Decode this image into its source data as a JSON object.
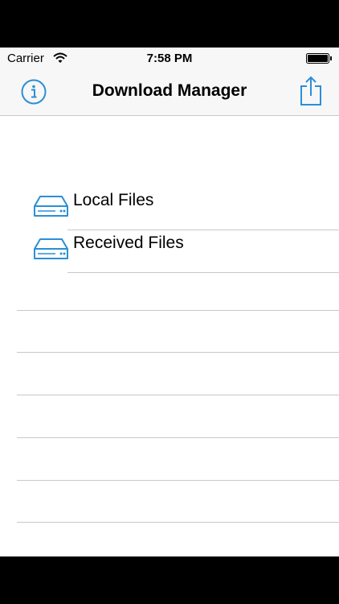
{
  "status_bar": {
    "carrier": "Carrier",
    "time": "7:58 PM",
    "wifi_icon": "wifi-icon",
    "battery_icon": "battery-icon"
  },
  "nav_bar": {
    "title": "Download Manager",
    "left_icon": "info-icon",
    "right_icon": "share-icon"
  },
  "list": {
    "items": [
      {
        "label": "Local Files",
        "icon": "hard-drive-icon"
      },
      {
        "label": "Received Files",
        "icon": "hard-drive-icon"
      }
    ]
  },
  "colors": {
    "accent": "#2b8fd6",
    "bar_background": "#f7f7f7",
    "separator": "#c8c7cc"
  }
}
